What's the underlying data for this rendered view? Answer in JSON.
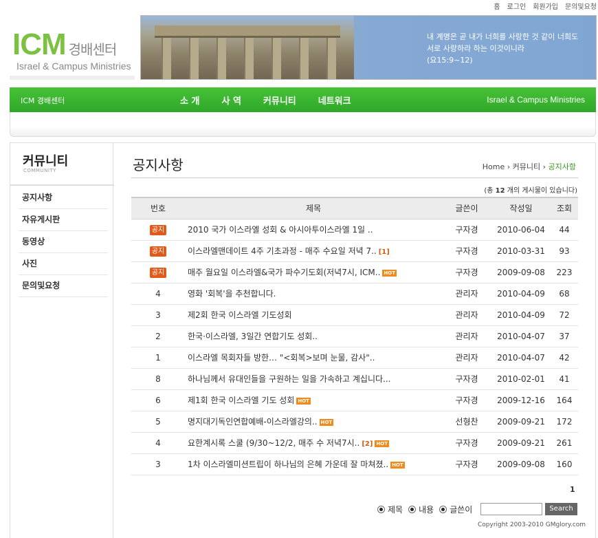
{
  "top_links": [
    "홈",
    "로그인",
    "회원가입",
    "문의및요청"
  ],
  "logo": {
    "main": "ICM",
    "korean": "경배센터",
    "english": "Israel & Campus Ministries"
  },
  "banner": {
    "line1": "내 계명은 곧 내가 너희를 사랑한 것 같이 너희도",
    "line2": "서로 사랑하라 하는 이것이니라",
    "line3": "(요15:9~12)"
  },
  "nav": {
    "brand": "ICM 경배센터",
    "items": [
      "소 개",
      "사 역",
      "커뮤니티",
      "네트워크"
    ],
    "right": "Israel & Campus Ministries"
  },
  "sidebar": {
    "title": "커뮤니티",
    "subtitle": "COMMUNITY",
    "items": [
      "공지사항",
      "자유게시판",
      "동영상",
      "사진",
      "문의및요청"
    ]
  },
  "page": {
    "title": "공지사항",
    "breadcrumb": {
      "home": "Home",
      "section": "커뮤니티",
      "current": "공지사항"
    },
    "count_prefix": "(총",
    "count": "12",
    "count_suffix": "개의 게시물이 있습니다)"
  },
  "table": {
    "headers": [
      "번호",
      "제목",
      "글쓴이",
      "작성일",
      "조회"
    ],
    "rows": [
      {
        "num": "공지",
        "notice": true,
        "title": "2010 국가 이스라엘 성회 & 아시아투이스라엘 1일 ..",
        "comments": "",
        "hot": false,
        "author": "구자경",
        "date": "2010-06-04",
        "views": "44"
      },
      {
        "num": "공지",
        "notice": true,
        "title": "이스라엘맨데이트 4주 기초과정 - 매주 수요일 저녁 7..",
        "comments": "[1]",
        "hot": false,
        "author": "구자경",
        "date": "2010-03-31",
        "views": "93"
      },
      {
        "num": "공지",
        "notice": true,
        "title": "매주 월요일 이스라엘&국가 파수기도회(저녁7시, ICM..",
        "comments": "",
        "hot": true,
        "author": "구자경",
        "date": "2009-09-08",
        "views": "223"
      },
      {
        "num": "4",
        "notice": false,
        "title": "영화 '회복'을 추천합니다.",
        "comments": "",
        "hot": false,
        "author": "관리자",
        "date": "2010-04-09",
        "views": "68"
      },
      {
        "num": "3",
        "notice": false,
        "title": "제2회 한국 이스라엘 기도성회",
        "comments": "",
        "hot": false,
        "author": "관리자",
        "date": "2010-04-09",
        "views": "72"
      },
      {
        "num": "2",
        "notice": false,
        "title": "한국·이스라엘, 3일간 연합기도 성회..",
        "comments": "",
        "hot": false,
        "author": "관리자",
        "date": "2010-04-07",
        "views": "37"
      },
      {
        "num": "1",
        "notice": false,
        "title": "이스라엘 목회자들 방한… \"<회복>보며 눈물, 감사\"..",
        "comments": "",
        "hot": false,
        "author": "관리자",
        "date": "2010-04-07",
        "views": "42"
      },
      {
        "num": "8",
        "notice": false,
        "title": "하나님께서 유대인들을 구원하는 일을 가속하고 계십니다...",
        "comments": "",
        "hot": false,
        "author": "구자경",
        "date": "2010-02-01",
        "views": "41"
      },
      {
        "num": "6",
        "notice": false,
        "title": "제1회 한국 이스라엘 기도 성회",
        "comments": "",
        "hot": true,
        "author": "구자경",
        "date": "2009-12-16",
        "views": "164"
      },
      {
        "num": "5",
        "notice": false,
        "title": "명지대기독인연합예배-이스라엘강의..",
        "comments": "",
        "hot": true,
        "author": "선형찬",
        "date": "2009-09-21",
        "views": "172"
      },
      {
        "num": "4",
        "notice": false,
        "title": "요한계시록 스쿨 (9/30~12/2, 매주 수 저녁7시..",
        "comments": "[2]",
        "hot": true,
        "author": "구자경",
        "date": "2009-09-21",
        "views": "261"
      },
      {
        "num": "3",
        "notice": false,
        "title": "1차 이스라엘미션트립이 하나님의 은혜 가운데 잘 마쳐졌..",
        "comments": "",
        "hot": true,
        "author": "구자경",
        "date": "2009-09-08",
        "views": "160"
      }
    ],
    "hot_label": "HOT"
  },
  "pager": {
    "current": "1"
  },
  "search": {
    "options": [
      "제목",
      "내용",
      "글쓴이"
    ],
    "value": "",
    "button": "Search"
  },
  "copyright": "Copyright 2003-2010 GMglory.com",
  "colors": {
    "brand_green": "#2fa82a",
    "notice_badge": "#e05a1a",
    "hot_badge": "#f08a1c"
  }
}
